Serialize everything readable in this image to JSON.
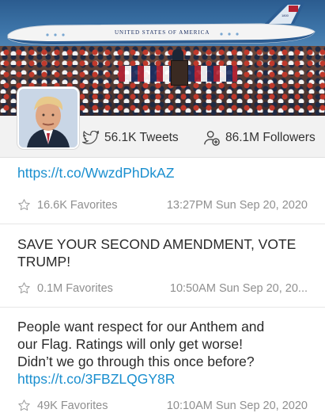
{
  "banner": {
    "plane_marking": "UNITED STATES OF AMERICA",
    "tail_number": "1800"
  },
  "profile": {
    "tweets": "56.1K Tweets",
    "followers": "86.1M Followers",
    "icons": {
      "tweets": "bird-icon",
      "followers": "person-add-icon"
    }
  },
  "tweets": [
    {
      "text_lines": [],
      "link": "https://t.co/WwzdPhDkAZ",
      "favorites": "16.6K Favorites",
      "timestamp": "13:27PM Sun Sep 20, 2020"
    },
    {
      "text_lines": [
        "SAVE YOUR SECOND AMENDMENT, VOTE",
        "TRUMP!"
      ],
      "link": "",
      "favorites": "0.1M Favorites",
      "timestamp": "10:50AM Sun Sep 20, 20..."
    },
    {
      "text_lines": [
        "People want respect for our Anthem and",
        "our Flag. Ratings will only get worse!",
        "Didn’t we go through this once before?"
      ],
      "link": "https://t.co/3FBZLQGY8R",
      "favorites": "49K Favorites",
      "timestamp": "10:10AM Sun Sep 20, 2020"
    }
  ],
  "colors": {
    "link": "#1a8fcf",
    "meta": "#8f8f8f",
    "profile_bar": "#f2f2f2"
  }
}
